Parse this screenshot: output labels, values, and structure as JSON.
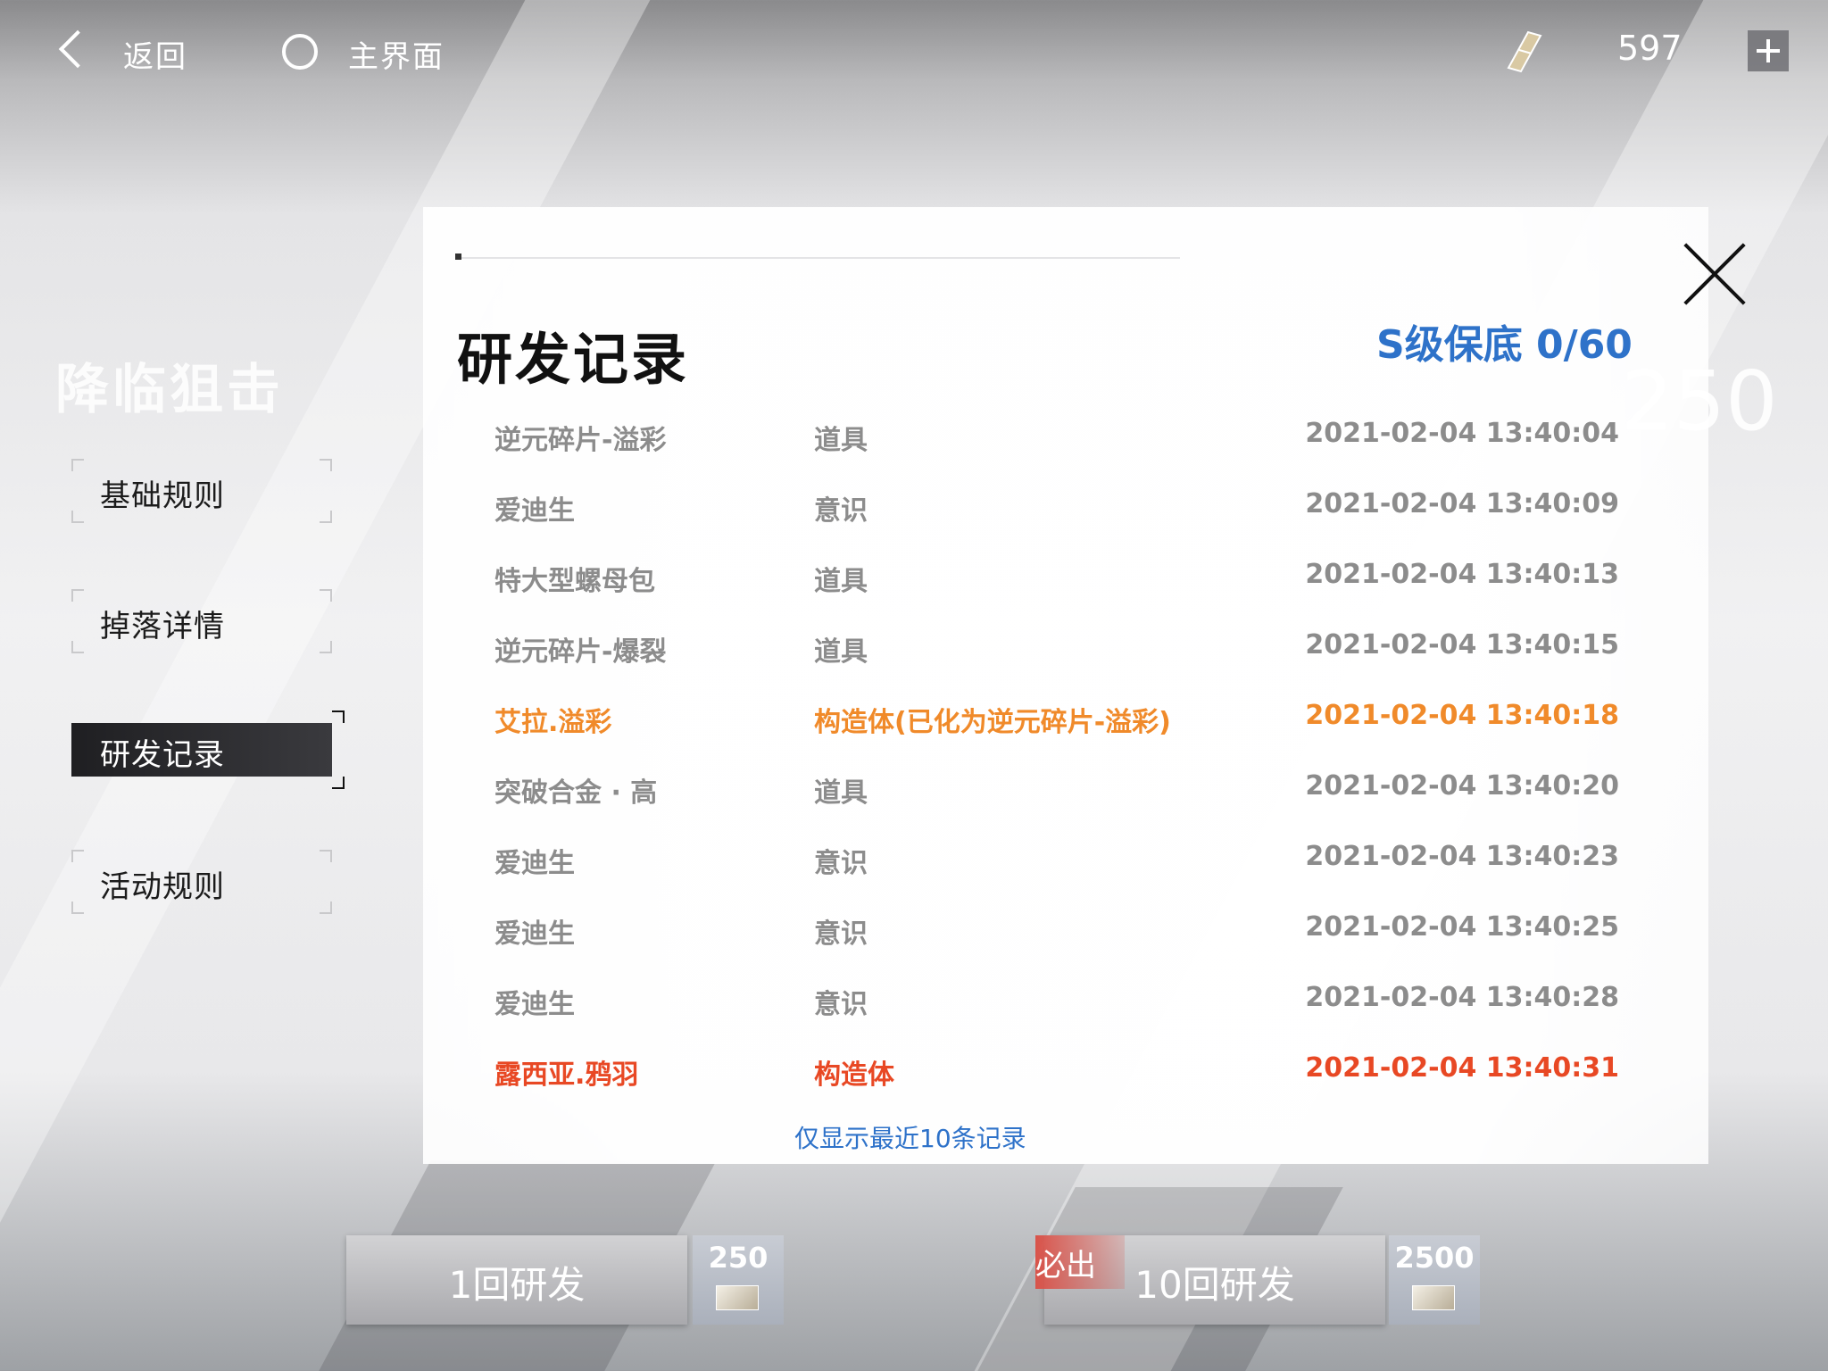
{
  "topbar": {
    "back_label": "返回",
    "home_label": "主界面",
    "currency_value": "597"
  },
  "background": {
    "event_title": "降临狙击",
    "faded_number": "250"
  },
  "nav": {
    "items": [
      {
        "label": "基础规则"
      },
      {
        "label": "掉落详情"
      },
      {
        "label": "研发记录"
      },
      {
        "label": "活动规则"
      }
    ]
  },
  "modal": {
    "title": "研发记录",
    "pity_counter": "S级保底 0/60",
    "records": [
      {
        "name": "逆元碎片-溢彩",
        "type": "道具",
        "time": "2021-02-04 13:40:04",
        "rarity": "normal"
      },
      {
        "name": "爱迪生",
        "type": "意识",
        "time": "2021-02-04 13:40:09",
        "rarity": "normal"
      },
      {
        "name": "特大型螺母包",
        "type": "道具",
        "time": "2021-02-04 13:40:13",
        "rarity": "normal"
      },
      {
        "name": "逆元碎片-爆裂",
        "type": "道具",
        "time": "2021-02-04 13:40:15",
        "rarity": "normal"
      },
      {
        "name": "艾拉.溢彩",
        "type": "构造体(已化为逆元碎片-溢彩)",
        "time": "2021-02-04 13:40:18",
        "rarity": "gold"
      },
      {
        "name": "突破合金 · 高",
        "type": "道具",
        "time": "2021-02-04 13:40:20",
        "rarity": "normal"
      },
      {
        "name": "爱迪生",
        "type": "意识",
        "time": "2021-02-04 13:40:23",
        "rarity": "normal"
      },
      {
        "name": "爱迪生",
        "type": "意识",
        "time": "2021-02-04 13:40:25",
        "rarity": "normal"
      },
      {
        "name": "爱迪生",
        "type": "意识",
        "time": "2021-02-04 13:40:28",
        "rarity": "normal"
      },
      {
        "name": "露西亚.鸦羽",
        "type": "构造体",
        "time": "2021-02-04 13:40:31",
        "rarity": "red"
      }
    ],
    "note": "仅显示最近10条记录"
  },
  "bottom": {
    "single_pull_label": "1回研发",
    "single_pull_cost": "250",
    "ten_pull_label": "10回研发",
    "ten_pull_cost": "2500",
    "guarantee_tag": "必出"
  },
  "colors": {
    "accent_blue": "#2e72c9",
    "gold_record": "#f08a2a",
    "red_record": "#e84824"
  }
}
